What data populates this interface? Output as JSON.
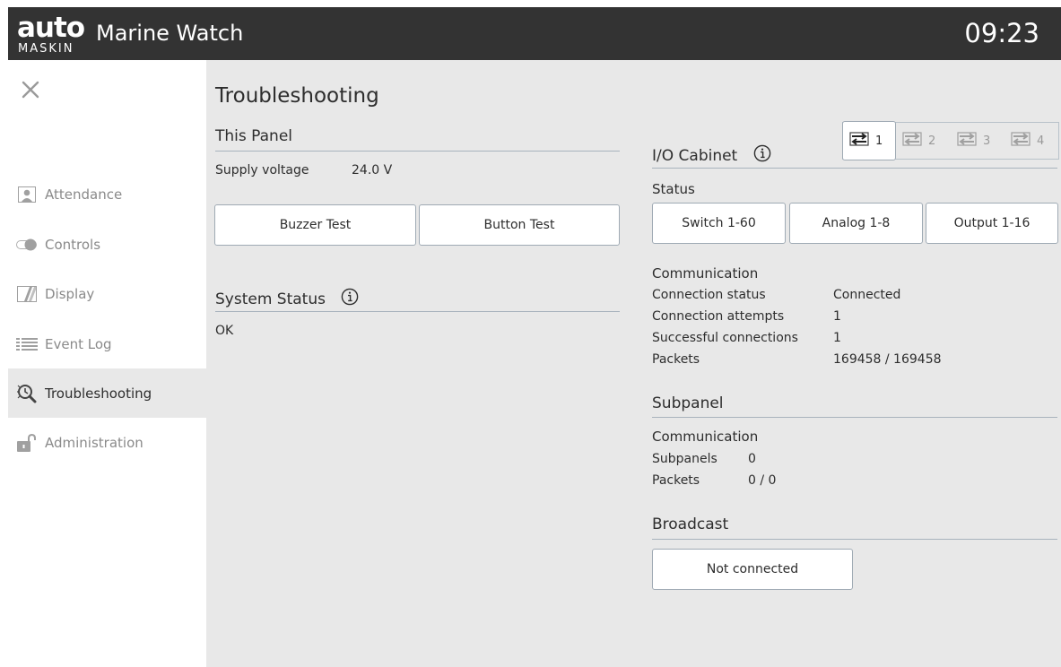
{
  "header": {
    "logo_top": "auto",
    "logo_bottom": "MASKIN",
    "title": "Marine Watch",
    "clock": "09:23"
  },
  "sidebar": {
    "items": [
      {
        "label": "Attendance",
        "icon": "person-icon"
      },
      {
        "label": "Controls",
        "icon": "toggle-icon"
      },
      {
        "label": "Display",
        "icon": "display-icon"
      },
      {
        "label": "Event Log",
        "icon": "list-icon"
      },
      {
        "label": "Troubleshooting",
        "icon": "troubleshoot-icon",
        "active": true
      },
      {
        "label": "Administration",
        "icon": "unlock-icon"
      }
    ]
  },
  "main": {
    "title": "Troubleshooting",
    "this_panel": {
      "heading": "This Panel",
      "supply_label": "Supply voltage",
      "supply_value": "24.0 V",
      "buzzer_button": "Buzzer Test",
      "button_test_button": "Button Test"
    },
    "system_status": {
      "heading": "System Status",
      "value": "OK"
    },
    "io_cabinet": {
      "heading": "I/O Cabinet",
      "cabinets": [
        "1",
        "2",
        "3",
        "4"
      ],
      "active_cabinet": "1",
      "status_heading": "Status",
      "switch_button": "Switch 1-60",
      "analog_button": "Analog 1-8",
      "output_button": "Output 1-16",
      "communication_heading": "Communication",
      "rows": [
        {
          "label": "Connection status",
          "value": "Connected"
        },
        {
          "label": "Connection attempts",
          "value": "1"
        },
        {
          "label": "Successful connections",
          "value": "1"
        },
        {
          "label": "Packets",
          "value": "169458 / 169458"
        }
      ]
    },
    "subpanel": {
      "heading": "Subpanel",
      "communication_heading": "Communication",
      "rows": [
        {
          "label": "Subpanels",
          "value": "0"
        },
        {
          "label": "Packets",
          "value": "0 / 0"
        }
      ]
    },
    "broadcast": {
      "heading": "Broadcast",
      "status_button": "Not connected"
    }
  },
  "colors": {
    "topbar": "#333333",
    "background": "#e8e8e8",
    "sidebar": "#ffffff",
    "rule": "#a8b3bd"
  }
}
